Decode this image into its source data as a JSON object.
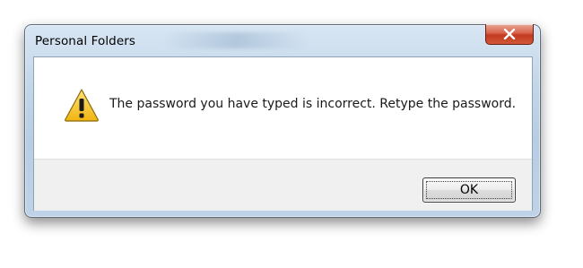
{
  "window": {
    "title": "Personal Folders"
  },
  "message": {
    "text": "The password you have typed is incorrect. Retype the password.",
    "icon": "warning-icon"
  },
  "buttons": {
    "ok_label": "OK",
    "close_icon": "close-icon"
  },
  "colors": {
    "frame": "#c3d7ea",
    "close_button": "#c23a1f",
    "warning_fill": "#f6c52c",
    "button_panel": "#f0f0f0"
  }
}
